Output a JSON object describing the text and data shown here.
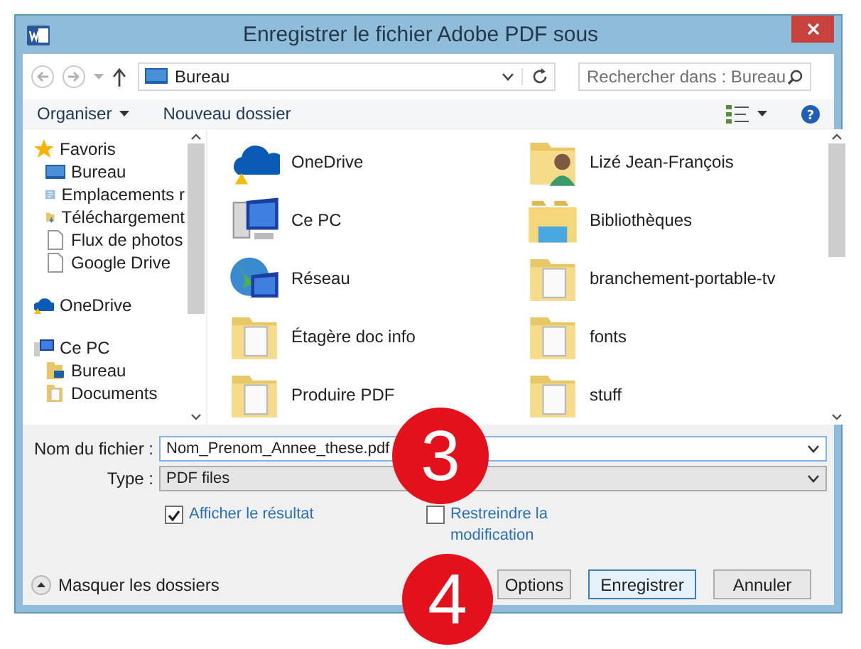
{
  "window": {
    "title": "Enregistrer le fichier Adobe PDF sous"
  },
  "address_bar": {
    "location": "Bureau"
  },
  "search": {
    "placeholder": "Rechercher dans : Bureau"
  },
  "toolbar": {
    "organize": "Organiser",
    "new_folder": "Nouveau dossier",
    "help": "?"
  },
  "sidebar": {
    "items": [
      {
        "label": "Favoris",
        "kind": "favorites",
        "children": [
          {
            "label": "Bureau",
            "kind": "desktop"
          },
          {
            "label": "Emplacements r",
            "kind": "places"
          },
          {
            "label": "Téléchargement",
            "kind": "downloads"
          },
          {
            "label": "Flux de photos",
            "kind": "file"
          },
          {
            "label": "Google Drive",
            "kind": "file"
          }
        ]
      },
      {
        "label": "OneDrive",
        "kind": "onedrive"
      },
      {
        "label": "Ce PC",
        "kind": "computer",
        "children": [
          {
            "label": "Bureau",
            "kind": "desktop-folder"
          },
          {
            "label": "Documents",
            "kind": "folder"
          }
        ]
      }
    ]
  },
  "files": [
    {
      "name": "OneDrive",
      "kind": "onedrive"
    },
    {
      "name": "Lizé Jean-François",
      "kind": "user-folder"
    },
    {
      "name": "Ce PC",
      "kind": "computer"
    },
    {
      "name": "Bibliothèques",
      "kind": "libraries"
    },
    {
      "name": "Réseau",
      "kind": "network"
    },
    {
      "name": "branchement-portable-tv",
      "kind": "folder"
    },
    {
      "name": "Étagère doc info",
      "kind": "folder"
    },
    {
      "name": "fonts",
      "kind": "folder"
    },
    {
      "name": "Produire PDF",
      "kind": "folder"
    },
    {
      "name": "stuff",
      "kind": "folder"
    }
  ],
  "file_name": {
    "label": "Nom du fichier :",
    "value": "Nom_Prenom_Annee_these.pdf"
  },
  "file_type": {
    "label": "Type :",
    "value": "PDF files"
  },
  "options": [
    {
      "label": "Afficher le résultat",
      "checked": true
    },
    {
      "label": "Restreindre la modification",
      "checked": false
    }
  ],
  "hide_folders": "Masquer les dossiers",
  "buttons": [
    {
      "label": "Options",
      "default": false
    },
    {
      "label": "Enregistrer",
      "default": true
    },
    {
      "label": "Annuler",
      "default": false
    }
  ],
  "annotations": [
    "3",
    "4"
  ]
}
